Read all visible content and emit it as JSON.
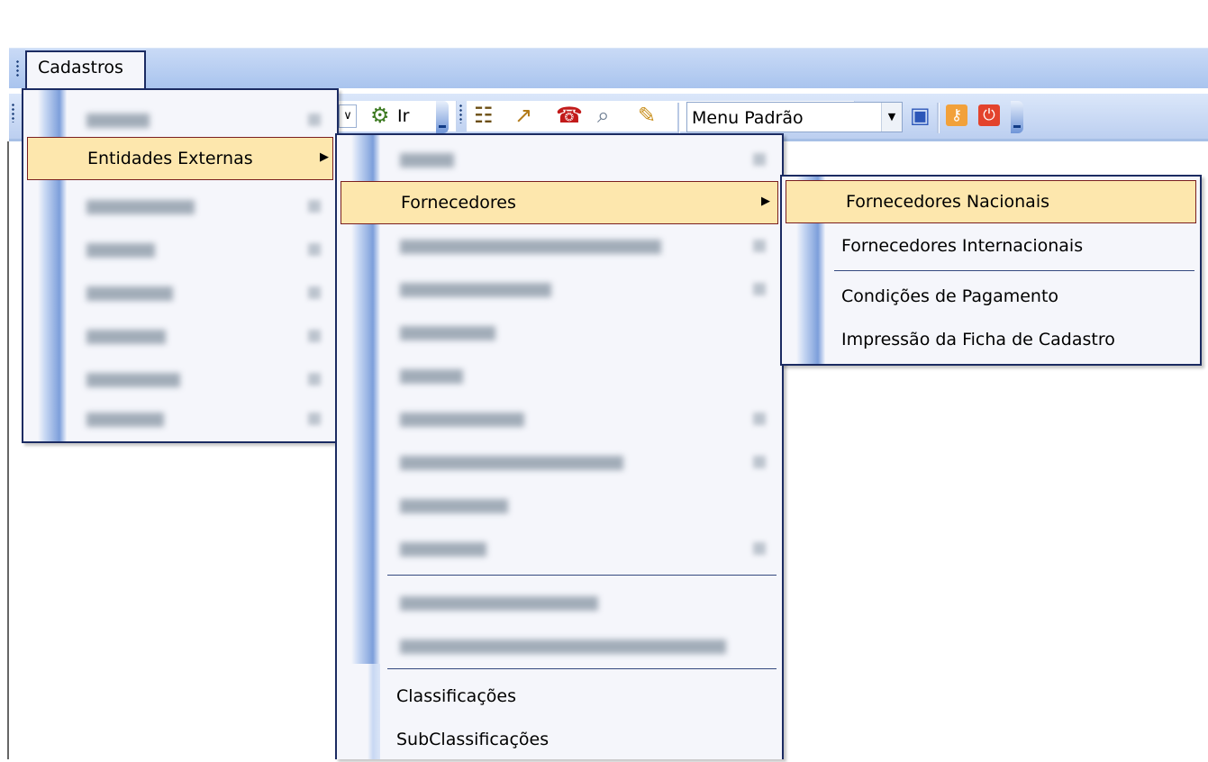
{
  "menubar": {
    "cadastros_label": "Cadastros"
  },
  "toolbar": {
    "go_label": "Ir",
    "combo_value": "Menu Padrão",
    "icons": [
      "refresh-icon",
      "people-icon",
      "chart-icon",
      "phone-icon",
      "search-icon",
      "pencil-icon",
      "save-icon",
      "key-icon",
      "power-icon"
    ]
  },
  "menu_level1": {
    "selected_item": "Entidades Externas",
    "blurred_items": 7
  },
  "menu_level2": {
    "selected_item": "Fornecedores",
    "items": [
      "Classificações",
      "SubClassificações"
    ]
  },
  "menu_level3": {
    "items": [
      "Fornecedores Nacionais",
      "Fornecedores Internacionais",
      "Condições de Pagamento",
      "Impressão da Ficha de Cadastro"
    ]
  },
  "colors": {
    "menubar": "#b9cff2",
    "highlight": "#fde7ad",
    "menu_border": "#1b2b62",
    "menu_background": "#f5f6fb"
  }
}
